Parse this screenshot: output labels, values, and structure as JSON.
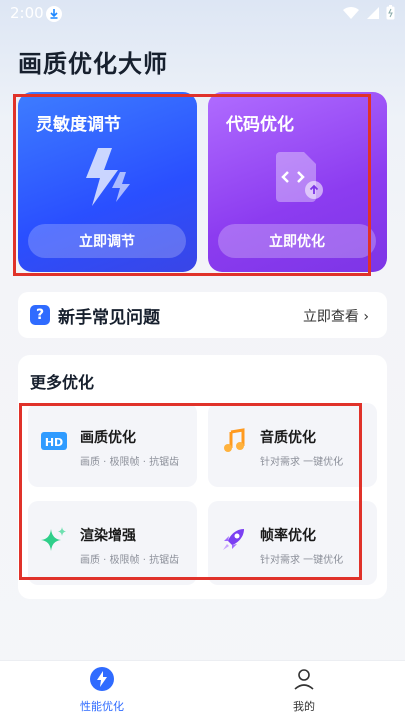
{
  "status_bar": {
    "time": "2:00"
  },
  "header": {
    "title": "画质优化大师"
  },
  "cards": [
    {
      "title": "灵敏度调节",
      "button": "立即调节",
      "icon": "lightning-icon",
      "color": "#3b62ff"
    },
    {
      "title": "代码优化",
      "button": "立即优化",
      "icon": "code-file-icon",
      "color": "#9a49f5"
    }
  ],
  "faq": {
    "title": "新手常见问题",
    "link": "立即查看",
    "icon": "question-icon"
  },
  "more": {
    "title": "更多优化",
    "items": [
      {
        "name": "画质优化",
        "desc": "画质 · 极限帧 · 抗锯齿",
        "icon": "hd-icon"
      },
      {
        "name": "音质优化",
        "desc": "针对需求 一键优化",
        "icon": "music-note-icon"
      },
      {
        "name": "渲染增强",
        "desc": "画质 · 极限帧 · 抗锯齿",
        "icon": "sparkle-icon"
      },
      {
        "name": "帧率优化",
        "desc": "针对需求 一键优化",
        "icon": "rocket-icon"
      }
    ]
  },
  "nav": {
    "items": [
      {
        "label": "性能优化",
        "icon": "lightning-circle-icon",
        "active": true
      },
      {
        "label": "我的",
        "icon": "person-icon",
        "active": false
      }
    ]
  }
}
